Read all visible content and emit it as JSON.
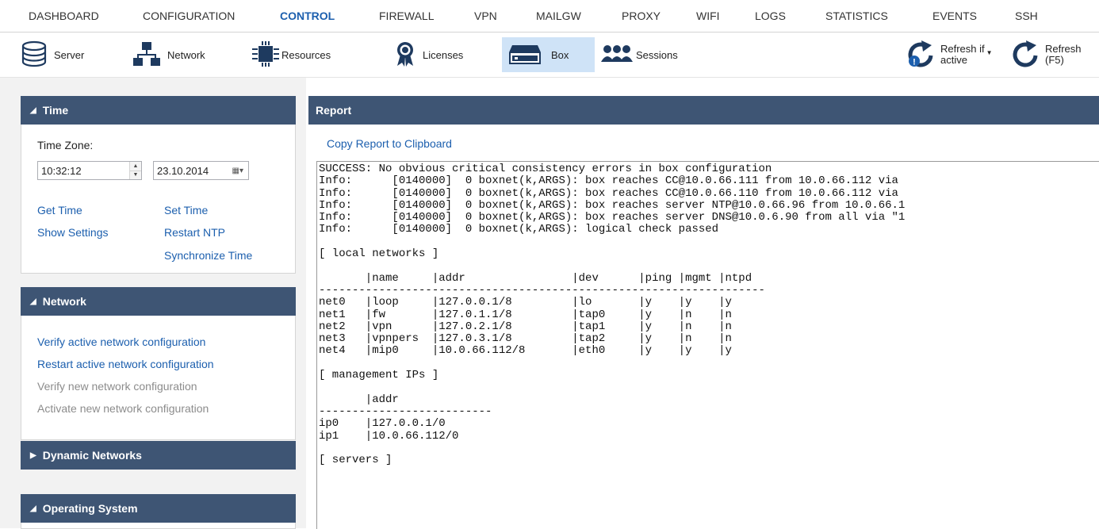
{
  "topnav": {
    "items": [
      "DASHBOARD",
      "CONFIGURATION",
      "CONTROL",
      "FIREWALL",
      "VPN",
      "MAILGW",
      "PROXY",
      "WIFI",
      "LOGS",
      "STATISTICS",
      "EVENTS",
      "SSH"
    ],
    "active": "CONTROL"
  },
  "toolbar": {
    "server": "Server",
    "network": "Network",
    "resources": "Resources",
    "licenses": "Licenses",
    "box": "Box",
    "sessions": "Sessions",
    "refresh_if_active_1": "Refresh if",
    "refresh_if_active_2": "active",
    "refresh_1": "Refresh",
    "refresh_2": "(F5)"
  },
  "colors": {
    "header_bg": "#3e5574",
    "link": "#1c5fae",
    "active_tab": "#1c5fae",
    "active_tool_bg": "#cfe3f7"
  },
  "left": {
    "time": {
      "title": "Time",
      "timezone_label": "Time Zone:",
      "time_value": "10:32:12",
      "date_value": "23.10.2014",
      "get_time": "Get Time",
      "set_time": "Set Time",
      "show_settings": "Show Settings",
      "restart_ntp": "Restart NTP",
      "synchronize_time": "Synchronize Time"
    },
    "network": {
      "title": "Network",
      "verify_active": "Verify active network configuration",
      "restart_active": "Restart active network configuration",
      "verify_new": "Verify new network configuration",
      "activate_new": "Activate new network configuration"
    },
    "dynamic_networks": {
      "title": "Dynamic Networks"
    },
    "operating_system": {
      "title": "Operating System"
    }
  },
  "report": {
    "title": "Report",
    "copy_link": "Copy Report to Clipboard",
    "text": "SUCCESS: No obvious critical consistency errors in box configuration\nInfo:      [0140000]  0 boxnet(k,ARGS): box reaches CC@10.0.66.111 from 10.0.66.112 via\nInfo:      [0140000]  0 boxnet(k,ARGS): box reaches CC@10.0.66.110 from 10.0.66.112 via\nInfo:      [0140000]  0 boxnet(k,ARGS): box reaches server NTP@10.0.66.96 from 10.0.66.1\nInfo:      [0140000]  0 boxnet(k,ARGS): box reaches server DNS@10.0.6.90 from all via \"1\nInfo:      [0140000]  0 boxnet(k,ARGS): logical check passed\n\n[ local networks ]\n\n       |name     |addr                |dev      |ping |mgmt |ntpd\n-------------------------------------------------------------------\nnet0   |loop     |127.0.0.1/8         |lo       |y    |y    |y\nnet1   |fw       |127.0.1.1/8         |tap0     |y    |n    |n\nnet2   |vpn      |127.0.2.1/8         |tap1     |y    |n    |n\nnet3   |vpnpers  |127.0.3.1/8         |tap2     |y    |n    |n\nnet4   |mip0     |10.0.66.112/8       |eth0     |y    |y    |y\n\n[ management IPs ]\n\n       |addr\n--------------------------\nip0    |127.0.0.1/0\nip1    |10.0.66.112/0\n\n[ servers ]"
  }
}
